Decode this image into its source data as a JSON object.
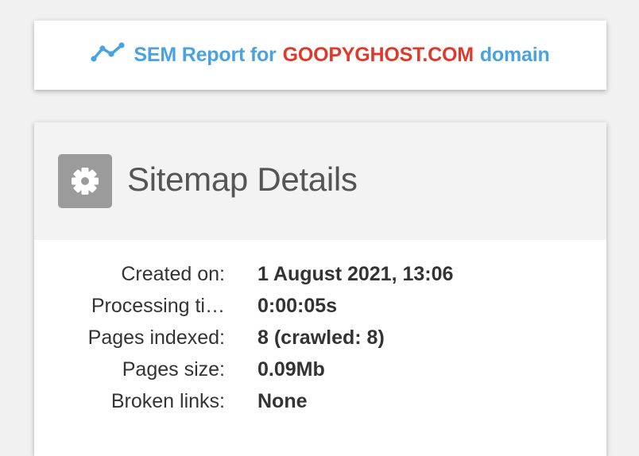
{
  "report": {
    "prefix": "SEM Report for",
    "domain": "GOOPYGHOST.COM",
    "suffix": "domain",
    "icon": "trend-line-icon",
    "accent_color": "#4aa3df",
    "domain_color": "#e0382a"
  },
  "sitemap": {
    "icon": "gear-icon",
    "title": "Sitemap Details",
    "rows": [
      {
        "label": "Created on:",
        "value": "1 August 2021, 13:06"
      },
      {
        "label": "Processing ti…",
        "value": "0:00:05s"
      },
      {
        "label": "Pages indexed:",
        "value": "8 (crawled: 8)"
      },
      {
        "label": "Pages size:",
        "value": "0.09Mb"
      },
      {
        "label": "Broken links:",
        "value": "None"
      }
    ]
  }
}
